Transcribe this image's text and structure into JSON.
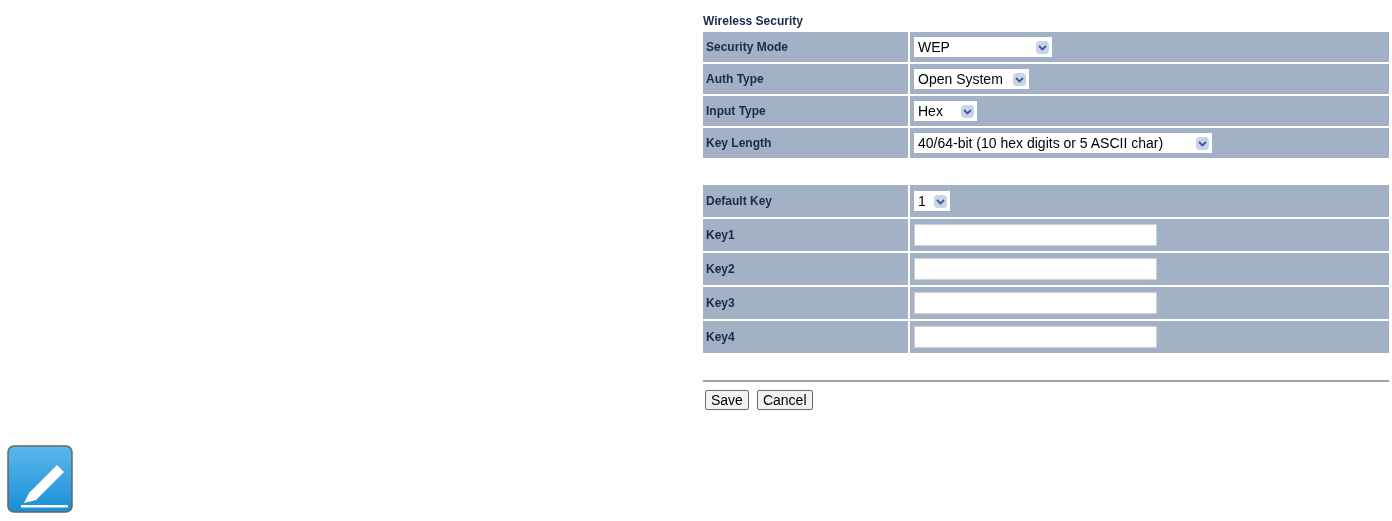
{
  "title": "Wireless Security",
  "groups": [
    {
      "rows": [
        {
          "label": "Security Mode",
          "kind": "select",
          "value": "WEP"
        },
        {
          "label": "Auth Type",
          "kind": "select",
          "value": "Open System"
        },
        {
          "label": "Input Type",
          "kind": "select",
          "value": "Hex"
        },
        {
          "label": "Key Length",
          "kind": "select",
          "value": "40/64-bit (10 hex digits or 5 ASCII char)"
        }
      ]
    },
    {
      "rows": [
        {
          "label": "Default Key",
          "kind": "select",
          "value": "1"
        },
        {
          "label": "Key1",
          "kind": "input"
        },
        {
          "label": "Key2",
          "kind": "input"
        },
        {
          "label": "Key3",
          "kind": "input"
        },
        {
          "label": "Key4",
          "kind": "input"
        }
      ]
    }
  ],
  "buttons": [
    "Save",
    "Cancel"
  ]
}
